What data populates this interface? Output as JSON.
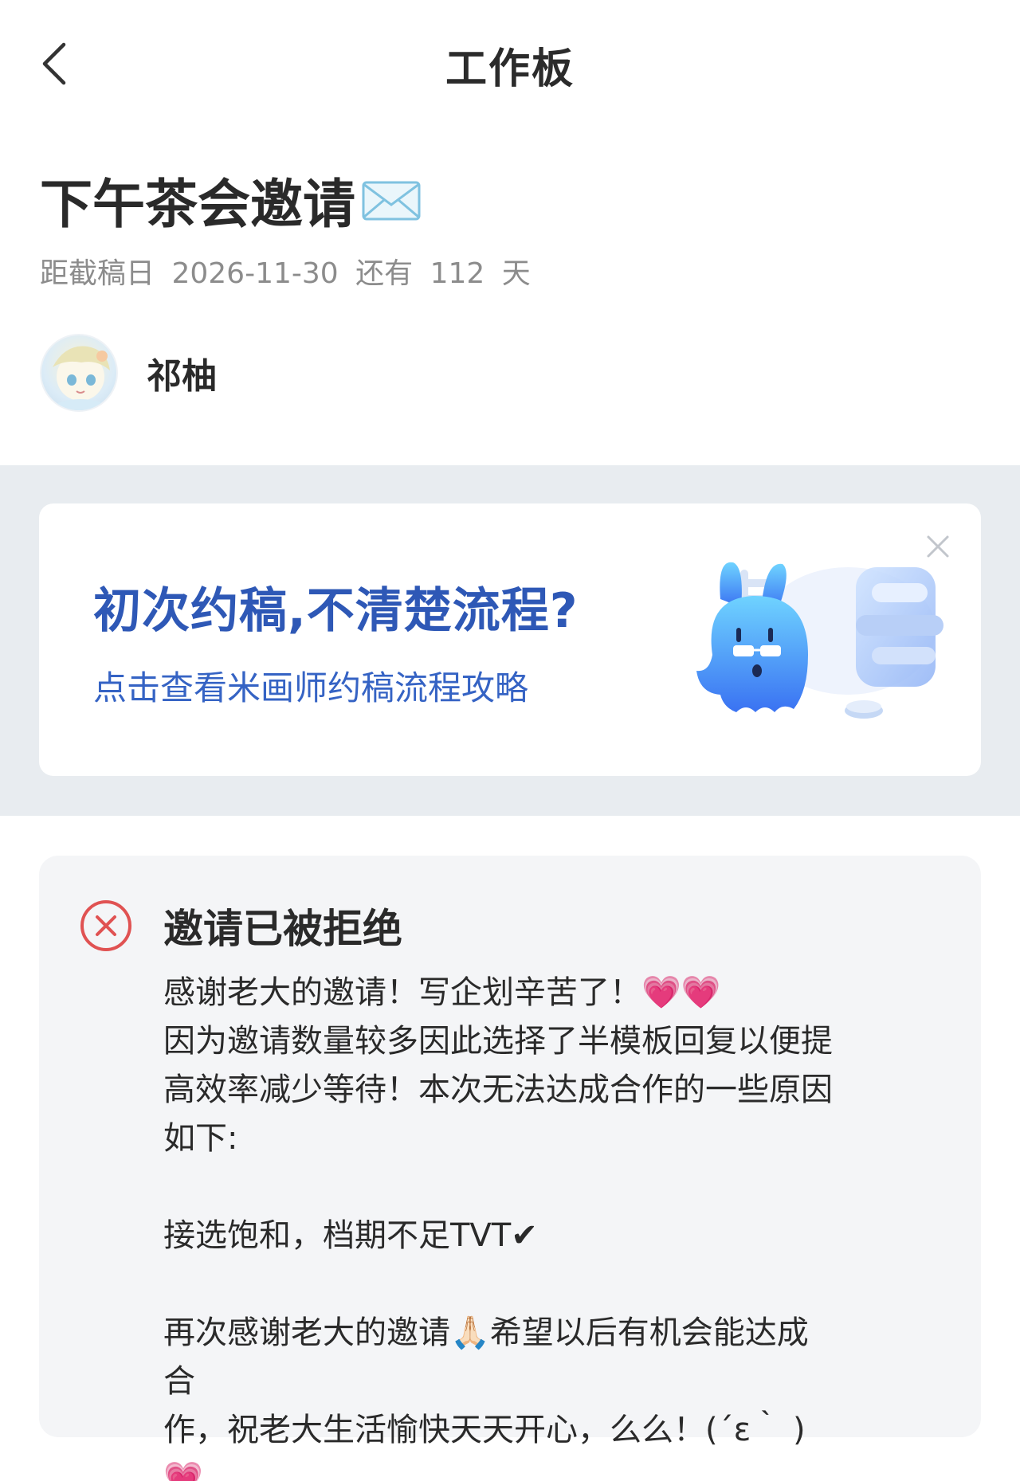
{
  "nav": {
    "title": "工作板"
  },
  "header": {
    "title": "下午茶会邀请",
    "title_emoji": "envelope-icon",
    "deadline_prefix": "距截稿日",
    "deadline_date": "2026-11-30",
    "deadline_mid": "还有",
    "deadline_days": "112",
    "deadline_unit": "天"
  },
  "author": {
    "name": "祁柚"
  },
  "banner": {
    "title": "初次约稿,不清楚流程?",
    "subtitle": "点击查看米画师约稿流程攻略",
    "accent": "#2e58b6"
  },
  "reply": {
    "status": "邀请已被拒绝",
    "status_color": "#e05252",
    "lines": [
      "感谢老大的邀请！写企划辛苦了！💗💗",
      "因为邀请数量较多因此选择了半模板回复以便提",
      "高效率减少等待！本次无法达成合作的一些原因",
      "如下:",
      "",
      "接选饱和，档期不足TVT✔",
      "",
      "再次感谢老大的邀请🙏🏻希望以后有机会能达成合",
      "作，祝老大生活愉快天天开心，么么！(´ε｀ )💗"
    ]
  }
}
